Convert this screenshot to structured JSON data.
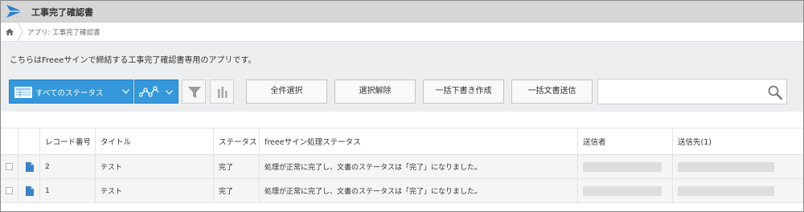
{
  "app": {
    "title": "工事完了確認書",
    "breadcrumb": "アプリ: 工事完了確認書",
    "description": "こちらはFreeeサインで締結する工事完了確認書専用のアプリです。"
  },
  "toolbar": {
    "view_label": "すべてのステータス",
    "select_all_label": "全件選択",
    "deselect_label": "選択解除",
    "bulk_draft_label": "一括下書き作成",
    "bulk_send_label": "一括文書送信",
    "search_value": ""
  },
  "table": {
    "headers": {
      "record_no": "レコード番号",
      "title": "タイトル",
      "status": "ステータス",
      "freee_status": "freeeサイン処理ステータス",
      "sender": "送信者",
      "destination": "送信先(1)"
    },
    "rows": [
      {
        "record_no": "2",
        "title": "テスト",
        "status": "完了",
        "freee_status": "処理が正常に完了し、文書のステータスは「完了」になりました。"
      },
      {
        "record_no": "1",
        "title": "テスト",
        "status": "完了",
        "freee_status": "処理が正常に完了し、文書のステータスは「完了」になりました。"
      }
    ]
  },
  "icons": {
    "logo": "kintone-logo-icon",
    "home": "home-icon",
    "view": "list-icon",
    "graph": "line-graph-icon",
    "filter": "filter-icon",
    "chart": "bar-chart-icon",
    "search": "search-icon",
    "document": "document-icon"
  },
  "colors": {
    "accent": "#3498db",
    "logo": "#2f7fd0",
    "toolbar_bg": "#eceeef",
    "titlebar_bg": "#d6d6d6"
  }
}
